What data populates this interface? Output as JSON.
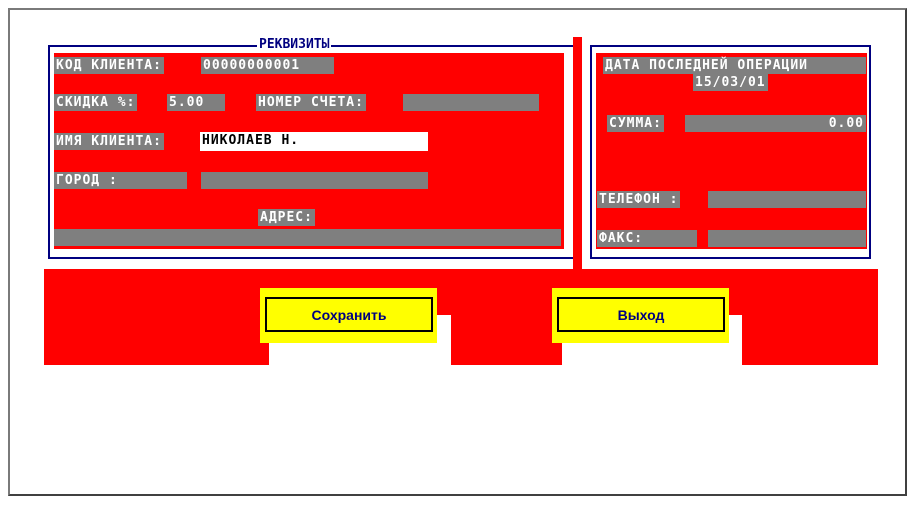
{
  "left_panel": {
    "title": "РЕКВИЗИТЫ",
    "client_code_label": "КОД КЛИЕНТА:",
    "client_code_value": "00000000001",
    "discount_label": "СКИДКА %:",
    "discount_value": "5.00",
    "account_label": "НОМЕР СЧЕТА:",
    "account_value": "",
    "client_name_label": "ИМЯ КЛИЕНТА:",
    "client_name_value": "НИКОЛАЕВ Н.",
    "city_label": "ГОРОД :",
    "city_value": "",
    "address_label": "АДРЕС:",
    "address_value": ""
  },
  "right_panel": {
    "last_op_label": "ДАТА ПОСЛЕДНЕЙ ОПЕРАЦИИ",
    "last_op_date": "15/03/01",
    "sum_label": "СУММА:",
    "sum_value": "0.00",
    "phone_label": "ТЕЛЕФОН :",
    "phone_value": "",
    "fax_label": "ФАКС:",
    "fax_value": ""
  },
  "buttons": {
    "save_label": "Сохранить",
    "exit_label": "Выход"
  },
  "colors": {
    "panel_bg": "#ff0000",
    "frame": "#000080",
    "field": "#7f7f7f",
    "button": "#ffff00"
  }
}
